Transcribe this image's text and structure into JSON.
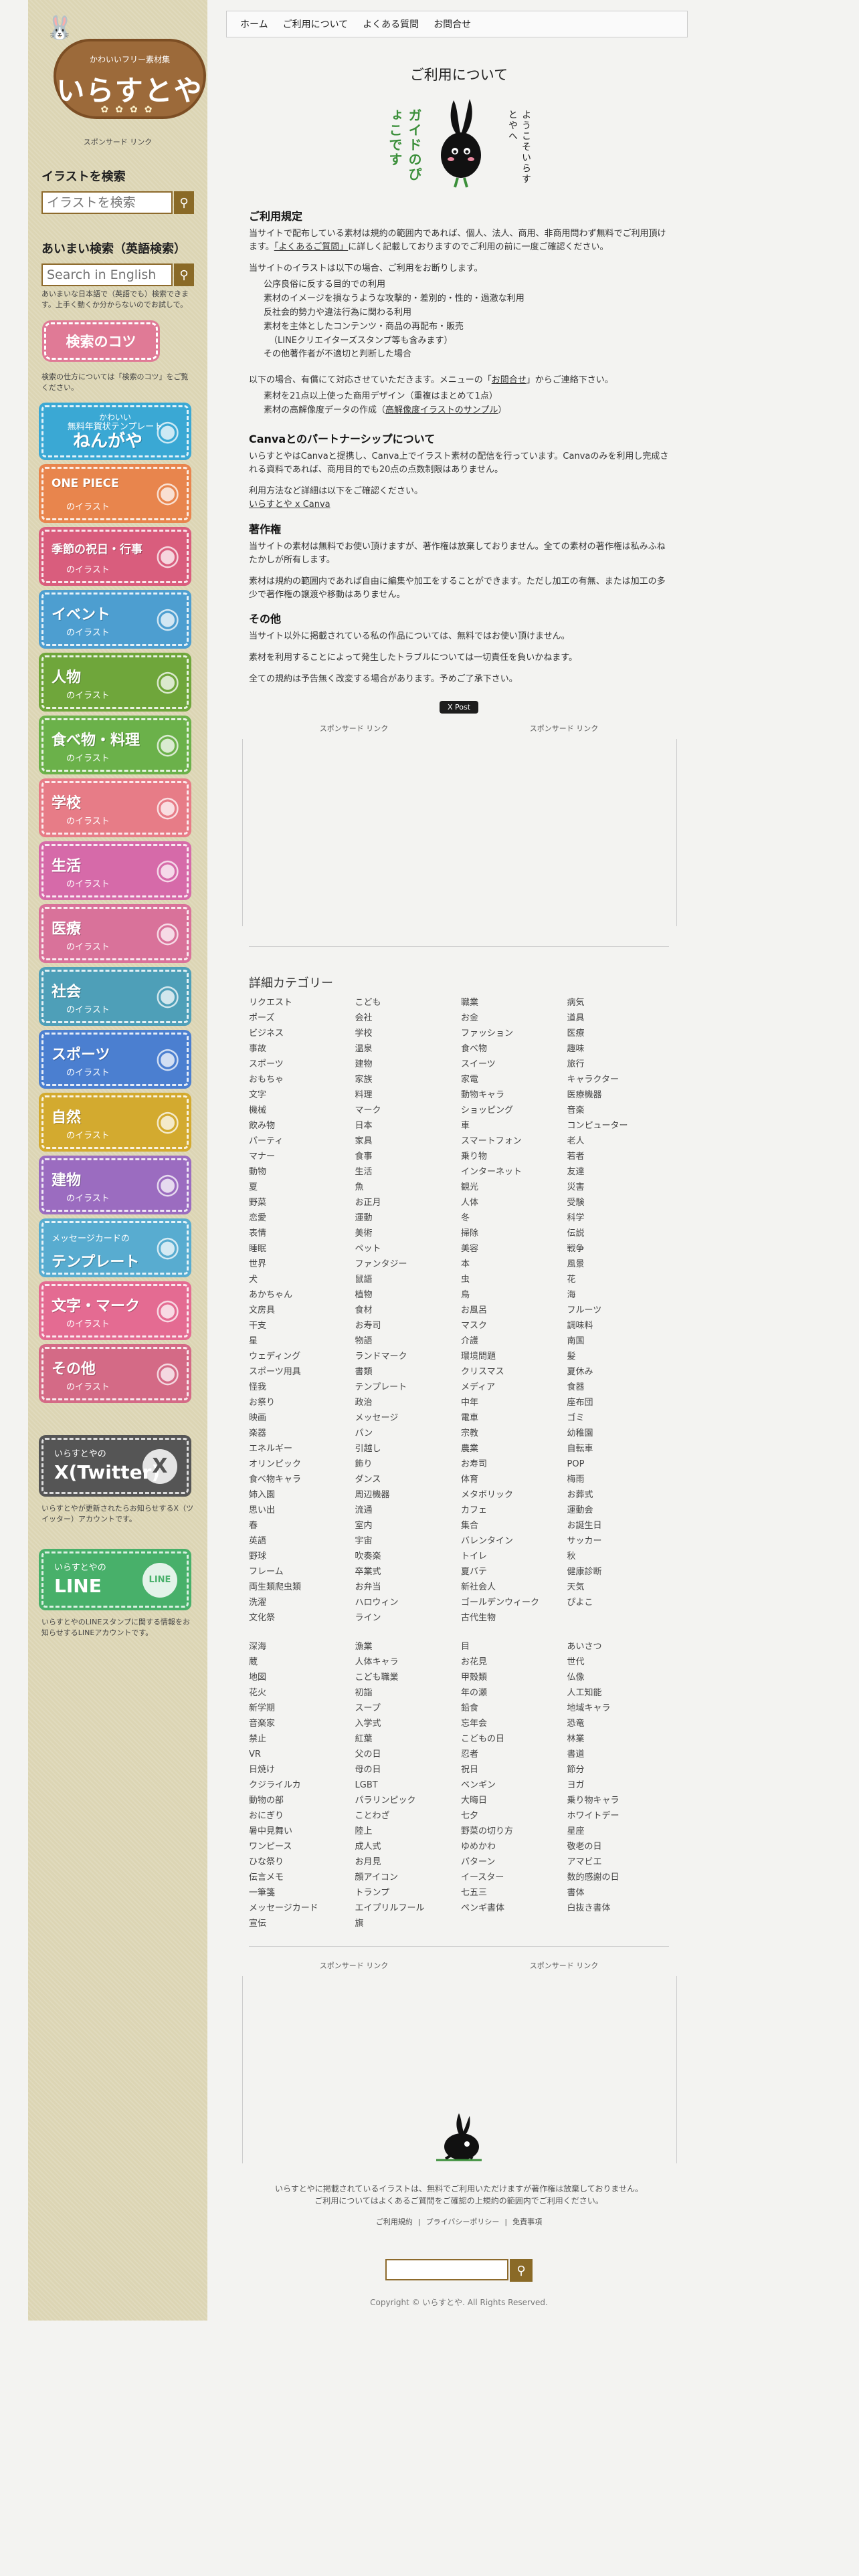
{
  "sidebar": {
    "logo": {
      "subtitle": "かわいいフリー素材集",
      "title": "いらすとや"
    },
    "sponsored_link": "スポンサード リンク",
    "search": {
      "heading": "イラストを検索",
      "placeholder": "イラストを検索"
    },
    "fuzzy_search": {
      "heading": "あいまい検索（英語検索）",
      "placeholder": "Search in English",
      "note": "あいまいな日本語で（英語でも）検索できます。上手く動くか分からないのでお試しで。"
    },
    "tips": {
      "label": "検索のコツ",
      "note": "検索の仕方については「検索のコツ」をご覧ください。"
    },
    "banners": [
      {
        "title": "ねんがや",
        "top": "かわいい",
        "sub2": "無料年賀状テンプレート",
        "color": "#3aa8d4",
        "icon": "horse-icon"
      },
      {
        "title": "ONE PIECE",
        "sub": "のイラスト",
        "color": "#e8854d",
        "icon": "luffy-icon"
      },
      {
        "title": "季節の祝日・行事",
        "sub": "のイラスト",
        "color": "#d95d7d",
        "icon": "festival-icon"
      },
      {
        "title": "イベント",
        "sub": "のイラスト",
        "color": "#4d9ed0",
        "icon": "couple-icon"
      },
      {
        "title": "人物",
        "sub": "のイラスト",
        "color": "#6fa63b",
        "icon": "person-icon"
      },
      {
        "title": "食べ物・料理",
        "sub": "のイラスト",
        "color": "#6bb14a",
        "icon": "rice-icon"
      },
      {
        "title": "学校",
        "sub": "のイラスト",
        "color": "#e77c87",
        "icon": "school-icon"
      },
      {
        "title": "生活",
        "sub": "のイラスト",
        "color": "#d66aa9",
        "icon": "house-icon"
      },
      {
        "title": "医療",
        "sub": "のイラスト",
        "color": "#d9729a",
        "icon": "doctor-icon"
      },
      {
        "title": "社会",
        "sub": "のイラスト",
        "color": "#4e9fb8",
        "icon": "business-icon"
      },
      {
        "title": "スポーツ",
        "sub": "のイラスト",
        "color": "#4b7fd0",
        "icon": "soccer-icon"
      },
      {
        "title": "自然",
        "sub": "のイラスト",
        "color": "#d3aa2f",
        "icon": "sunflower-icon"
      },
      {
        "title": "建物",
        "sub": "のイラスト",
        "color": "#9b6cc0",
        "icon": "building-icon"
      },
      {
        "title": "テンプレート",
        "sub": "メッセージカードの",
        "color": "#58acd0",
        "icon": "card-icon"
      },
      {
        "title": "文字・マーク",
        "sub": "のイラスト",
        "color": "#e46b92",
        "icon": "letter-icon"
      },
      {
        "title": "その他",
        "sub": "のイラスト",
        "color": "#d46a86",
        "icon": "misc-icon"
      }
    ],
    "twitter": {
      "top": "いらすとやの",
      "title": "X(Twitter)",
      "note": "いらすとやが更新されたらお知らせするX（ツイッター）アカウントです。",
      "color": "#555555"
    },
    "line": {
      "top": "いらすとやの",
      "title": "LINE",
      "note": "いらすとやのLINEスタンプに関する情報をお知らせするLINEアカウントです。",
      "color": "#48b06a"
    }
  },
  "nav": {
    "items": [
      "ホーム",
      "ご利用について",
      "よくある質問",
      "お問合せ"
    ]
  },
  "main": {
    "title": "ご利用について",
    "hero": {
      "left": "ガイドのぴょこです",
      "right": "ようこそいらすとやへ"
    },
    "rules": {
      "heading": "ご利用規定",
      "p1a": "当サイトで配布している素材は規約の範囲内であれば、個人、法人、商用、非商用問わず無料でご利用頂けます。",
      "p1link": "「よくあるご質問」",
      "p1b": "に詳しく記載しておりますのでご利用の前に一度ご確認ください。",
      "p2": "当サイトのイラストは以下の場合、ご利用をお断りします。",
      "deny": [
        "公序良俗に反する目的での利用",
        "素材のイメージを損なうような攻撃的・差別的・性的・過激な利用",
        "反社会的勢力や違法行為に関わる利用",
        "素材を主体としたコンテンツ・商品の再配布・販売",
        "（LINEクリエイターズスタンプ等も含みます）",
        "その他著作者が不適切と判断した場合"
      ],
      "p3a": "以下の場合、有償にて対応させていただきます。メニューの「",
      "p3link": "お問合せ",
      "p3b": "」からご連絡下さい。",
      "paid": [
        "素材を21点以上使った商用デザイン（重複はまとめて1点）"
      ],
      "paid2a": "素材の高解像度データの作成（",
      "paid2link": "高解像度イラストのサンプル",
      "paid2b": "）"
    },
    "canva": {
      "heading": "Canvaとのパートナーシップについて",
      "p1": "いらすとやはCanvaと提携し、Canva上でイラスト素材の配信を行っています。Canvaのみを利用し完成される資料であれば、商用目的でも20点の点数制限はありません。",
      "p2": "利用方法など詳細は以下をご確認ください。",
      "link": "いらすとや x Canva"
    },
    "copyright": {
      "heading": "著作権",
      "p1": "当サイトの素材は無料でお使い頂けますが、著作権は放棄しておりません。全ての素材の著作権は私みふねたかしが所有します。",
      "p2": "素材は規約の範囲内であれば自由に編集や加工をすることができます。ただし加工の有無、または加工の多少で著作権の譲渡や移動はありません。"
    },
    "other": {
      "heading": "その他",
      "p1": "当サイト以外に掲載されている私の作品については、無料ではお使い頂けません。",
      "p2": "素材を利用することによって発生したトラブルについては一切責任を負いかねます。",
      "p3": "全ての規約は予告無く改変する場合があります。予めご了承下さい。"
    },
    "tweet": "X Post",
    "sponsored": "スポンサード リンク",
    "categories_heading": "詳細カテゴリー",
    "categories": [
      [
        "リクエスト",
        "こども",
        "職業",
        "病気",
        "ポーズ",
        "会社",
        "お金",
        "道具",
        "ビジネス",
        "学校",
        "ファッション",
        "医療",
        "事故",
        "温泉",
        "食べ物",
        "趣味",
        "スポーツ",
        "建物",
        "スイーツ",
        "旅行",
        "おもちゃ",
        "家族",
        "家電",
        "キャラクター",
        "文字",
        "料理",
        "動物キャラ",
        "医療機器",
        "機械",
        "マーク",
        "ショッピング",
        "音楽",
        "飲み物",
        "日本",
        "車",
        "コンピューター",
        "パーティ",
        "家具",
        "スマートフォン",
        "老人",
        "マナー",
        "食事",
        "乗り物",
        "若者",
        "動物",
        "生活",
        "インターネット",
        "友達",
        "夏",
        "魚",
        "観光",
        "災害",
        "野菜",
        "お正月",
        "人体",
        "受験",
        "恋愛",
        "運動",
        "冬",
        "科学",
        "表情",
        "美術",
        "掃除",
        "伝説",
        "睡眠",
        "ペット",
        "美容",
        "戦争",
        "世界",
        "ファンタジー",
        "本",
        "風景",
        "犬",
        "鼠語",
        "虫",
        "花",
        "あかちゃん",
        "植物",
        "鳥",
        "海",
        "文房具",
        "食材",
        "お風呂",
        "フルーツ",
        "干支",
        "お寿司",
        "マスク",
        "調味料",
        "星",
        "物語",
        "介護",
        "南国",
        "ウェディング",
        "ランドマーク",
        "環境問題",
        "髪",
        "スポーツ用具",
        "書類",
        "クリスマス",
        "夏休み",
        "怪我",
        "テンプレート",
        "メディア",
        "食器",
        "お祭り",
        "政治",
        "中年",
        "座布団",
        "映画",
        "メッセージ",
        "電車",
        "ゴミ",
        "楽器",
        "パン",
        "宗教",
        "幼稚園",
        "エネルギー",
        "引越し",
        "農業",
        "自転車",
        "オリンピック",
        "飾り",
        "お寿司",
        "POP",
        "食べ物キャラ",
        "ダンス",
        "体育",
        "梅雨",
        "姉入園",
        "周辺機器",
        "メタボリック",
        "お葬式",
        "思い出",
        "流通",
        "カフェ",
        "運動会",
        "春",
        "室内",
        "集合",
        "お誕生日",
        "英語",
        "宇宙",
        "バレンタイン",
        "サッカー",
        "野球",
        "吹奏楽",
        "トイレ",
        "秋",
        "フレーム",
        "卒業式",
        "夏バテ",
        "健康診断",
        "両生類爬虫類",
        "お弁当",
        "新社会人",
        "天気",
        "洗濯",
        "ハロウィン",
        "ゴールデンウィーク",
        "ぴよこ",
        "文化祭",
        "ライン",
        "古代生物"
      ],
      [
        "深海",
        "漁業",
        "目",
        "あいさつ",
        "蔵",
        "人体キャラ",
        "お花見",
        "世代",
        "地図",
        "こども職業",
        "甲殻類",
        "仏像",
        "花火",
        "初詣",
        "年の瀬",
        "人工知能",
        "新学期",
        "スープ",
        "鉛食",
        "地域キャラ",
        "音楽家",
        "入学式",
        "忘年会",
        "恐竜",
        "禁止",
        "紅葉",
        "こどもの日",
        "林業",
        "VR",
        "父の日",
        "忍者",
        "書道",
        "日焼け",
        "母の日",
        "祝日",
        "節分",
        "クジライルカ",
        "LGBT",
        "ベンギン",
        "ヨガ",
        "動物の部",
        "パラリンピック",
        "大晦日",
        "乗り物キャラ",
        "おにぎり",
        "ことわざ",
        "七夕",
        "ホワイトデー",
        "暑中見舞い",
        "陸上",
        "野菜の切り方",
        "星座",
        "ワンピース",
        "成人式",
        "ゆめかわ",
        "敬老の日",
        "ひな祭り",
        "お月見",
        "パターン",
        "アマビエ",
        "伝言メモ",
        "顔アイコン",
        "イースター",
        "数的感謝の日",
        "一筆箋",
        "トランプ",
        "七五三",
        "書体",
        "メッセージカード",
        "エイプリルフール",
        "ペンギ書体",
        "白抜き書体",
        "宣伝",
        "旗"
      ]
    ]
  },
  "footer": {
    "note1": "いらすとやに掲載されているイラストは、無料でご利用いただけますが著作権は放棄しておりません。",
    "note2": "ご利用についてはよくあるご質問をご確認の上規約の範囲内でご利用ください。",
    "links": [
      "ご利用規約",
      "プライバシーポリシー",
      "免責事項"
    ],
    "copyright": "Copyright © いらすとや. All Rights Reserved."
  }
}
